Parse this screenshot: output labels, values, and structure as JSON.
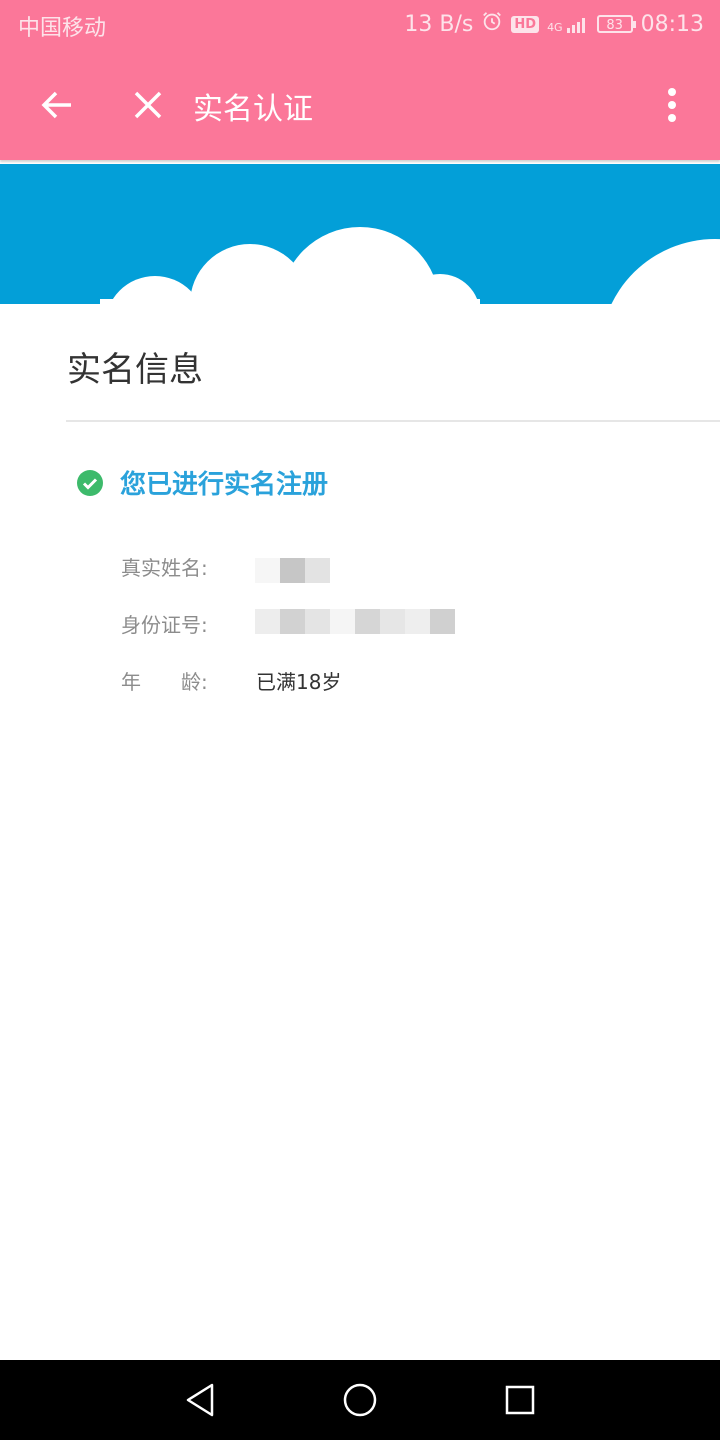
{
  "status_bar": {
    "carrier": "中国移动",
    "speed": "13 B/s",
    "signal_label": "4G",
    "hd_badge": "HD",
    "battery": "83",
    "time": "08:13"
  },
  "toolbar": {
    "title": "实名认证",
    "back_icon": "arrow-left-icon",
    "close_icon": "close-icon",
    "more_icon": "more-vertical-icon"
  },
  "banner": {
    "background_color": "#039fd8",
    "cloud_color": "#ffffff"
  },
  "section": {
    "title": "实名信息",
    "verified_text": "您已进行实名注册",
    "verified_icon": "check-circle-icon"
  },
  "fields": [
    {
      "label": "真实姓名:",
      "value": "",
      "redacted": true
    },
    {
      "label": "身份证号:",
      "value": "",
      "redacted": true
    },
    {
      "label": "年　　龄:",
      "value": "已满18岁",
      "redacted": false
    }
  ],
  "colors": {
    "accent": "#fb7799",
    "verified_text": "#2aa2db",
    "check_green": "#3dba6b"
  },
  "nav": {
    "back_icon": "triangle-back-icon",
    "home_icon": "circle-home-icon",
    "recent_icon": "square-recent-icon"
  }
}
